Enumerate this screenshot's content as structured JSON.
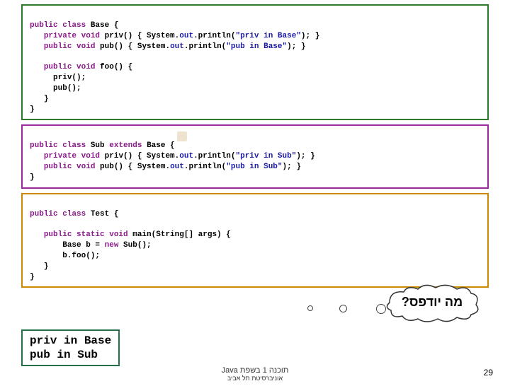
{
  "base": {
    "decl_pre": "public class ",
    "name": "Base",
    "decl_post": " {",
    "priv_pre": "private void ",
    "priv_sig": "priv() { System.",
    "out": "out",
    "println_open": ".println(",
    "priv_str": "\"priv in Base\"",
    "close_stmt": "); }",
    "pub_pre": "public void ",
    "pub_sig": "pub() { System.",
    "pub_str": "\"pub in Base\"",
    "foo_decl": "public void ",
    "foo_sig": "foo() {",
    "foo_l1": "priv();",
    "foo_l2": "pub();",
    "foo_close": "}",
    "class_close": "}"
  },
  "sub": {
    "decl_pre": "public class ",
    "name": "Sub",
    "extends": " extends ",
    "parent": "Base ",
    "decl_post": "{",
    "priv_pre": "private void ",
    "priv_sig": "priv() { System.",
    "out": "out",
    "println_open": ".println(",
    "priv_str": "\"priv in Sub\"",
    "close_stmt": "); }",
    "pub_pre": "public void ",
    "pub_sig": "pub() { System.",
    "pub_str": "\"pub in Sub\"",
    "class_close": "}"
  },
  "test": {
    "decl_pre": "public class ",
    "name": "Test",
    "decl_post": " {",
    "main_pre": "public static void ",
    "main_sig": "main(String[] args) {",
    "l1a": "Base b = ",
    "l1_new": "new",
    "l1b": " Sub();",
    "l2": "b.foo();",
    "main_close": "}",
    "class_close": "}"
  },
  "output": "priv in Base\npub in Sub",
  "speech": "מה יודפס?",
  "footer_main": "תוכנה 1 בשפת Java",
  "footer_sub": "אוניברסיטת תל אביב",
  "page": "29"
}
